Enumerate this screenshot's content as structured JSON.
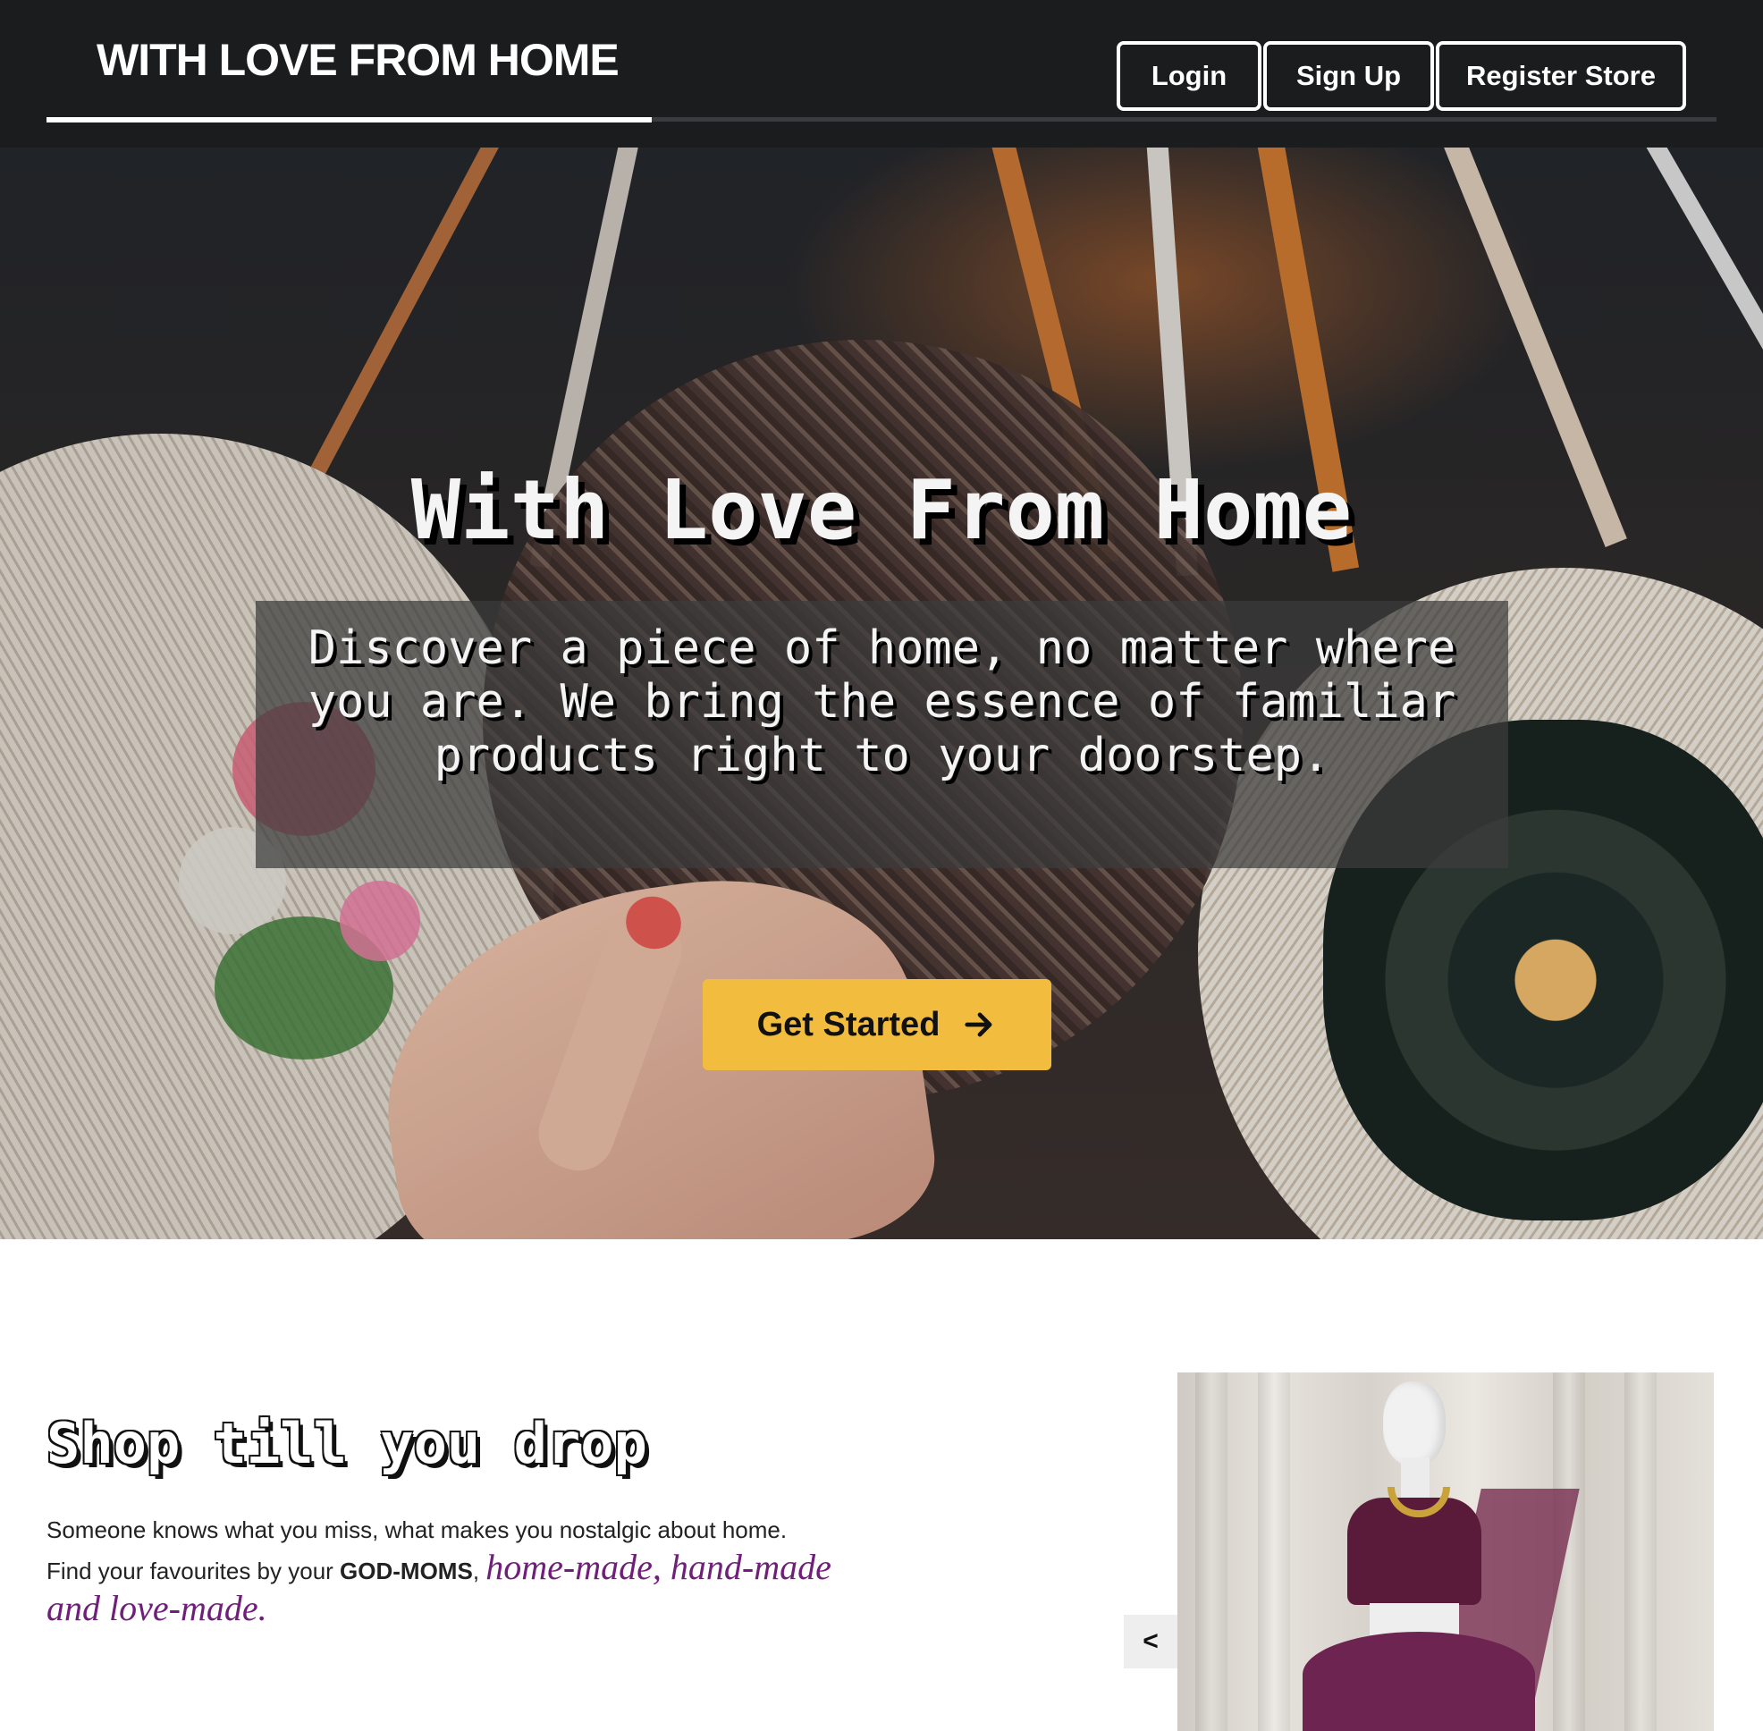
{
  "header": {
    "brand": "WITH LOVE FROM HOME",
    "nav": {
      "login": "Login",
      "signup": "Sign Up",
      "register": "Register Store"
    }
  },
  "hero": {
    "title": "With Love From Home",
    "subtitle": "Discover a piece of home, no matter where you are. We bring the essence of familiar products right to your doorstep.",
    "cta_label": "Get Started",
    "cta_icon": "arrow-right-icon",
    "background_image": "woven-rattan-bags-photo"
  },
  "shop": {
    "title": "Shop till you drop",
    "line1": "Someone knows what you miss, what makes you nostalgic about home.",
    "line2_prefix": "Find your favourites by your",
    "line2_emphasis": "GOD-MOMS",
    "line2_comma": ",",
    "tagline": "home-made, hand-made and love-made.",
    "carousel_prev_label": "<",
    "carousel_image": "lehenga-on-mannequin-photo"
  },
  "colors": {
    "header_bg": "#1b1c1e",
    "accent": "#f2bd3f",
    "tagline": "#6f1f7a"
  }
}
